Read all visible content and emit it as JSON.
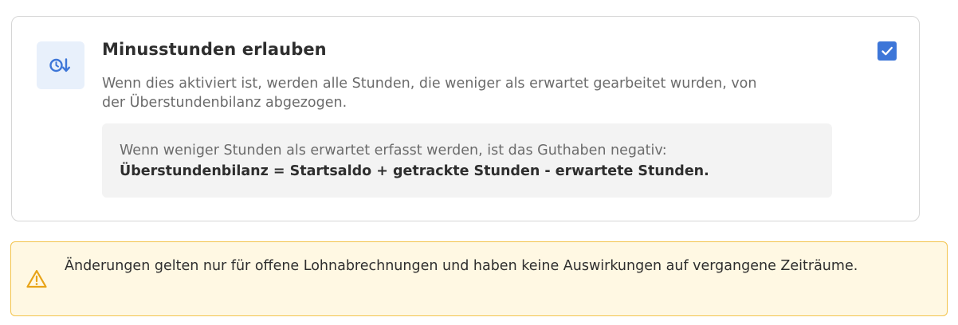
{
  "setting": {
    "icon": "clock-arrow-down-icon",
    "title": "Minusstunden erlauben",
    "description": "Wenn dies aktiviert ist, werden alle Stunden, die weniger als erwartet gearbeitet wurden, von der Überstundenbilanz abgezogen.",
    "checked": true,
    "info": {
      "text": "Wenn weniger Stunden als erwartet erfasst werden, ist das Guthaben negativ:",
      "formula": "Überstundenbilanz = Startsaldo + getrackte Stunden - erwartete Stunden."
    }
  },
  "warning": {
    "icon": "warning-triangle-icon",
    "text": "Änderungen gelten nur für offene Lohnabrechnungen und haben keine Auswirkungen auf vergangene Zeiträume."
  },
  "colors": {
    "accent": "#3d76d8",
    "icon_bg": "#e8f0fb",
    "warning_border": "#f3c44d",
    "warning_bg": "#fff8e3",
    "warning_icon": "#e8a317"
  }
}
